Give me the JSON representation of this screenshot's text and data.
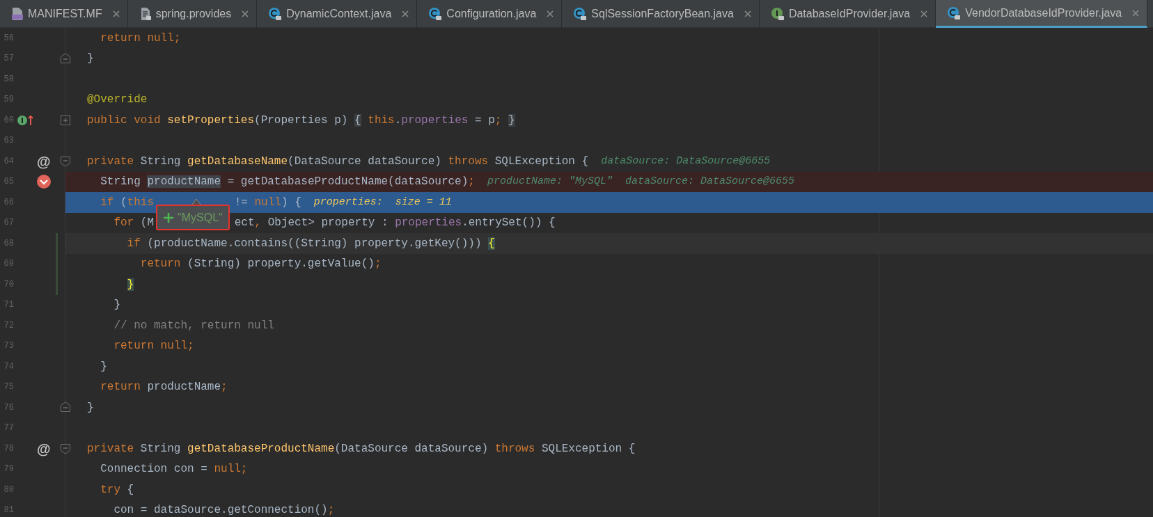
{
  "tabs": [
    {
      "label": "MANIFEST.MF",
      "kind": "manifest",
      "selected": false
    },
    {
      "label": "spring.provides",
      "kind": "text",
      "selected": false
    },
    {
      "label": "DynamicContext.java",
      "kind": "class",
      "selected": false
    },
    {
      "label": "Configuration.java",
      "kind": "class",
      "selected": false
    },
    {
      "label": "SqlSessionFactoryBean.java",
      "kind": "class",
      "selected": false
    },
    {
      "label": "DatabaseIdProvider.java",
      "kind": "interface",
      "selected": false
    },
    {
      "label": "VendorDatabaseIdProvider.java",
      "kind": "class",
      "selected": true
    }
  ],
  "editor": {
    "lines": [
      {
        "number": "56",
        "tokens": [
          {
            "kind": "keyword",
            "text": "  return null;"
          }
        ]
      },
      {
        "number": "57",
        "fold": {
          "kind": "end"
        },
        "tokens": [
          {
            "kind": "plain",
            "text": "}"
          }
        ]
      },
      {
        "number": "58"
      },
      {
        "number": "59",
        "tokens": [
          {
            "kind": "annotation",
            "text": "@Override"
          }
        ]
      },
      {
        "number": "60",
        "fold": {
          "kind": "collapsed"
        },
        "mark": {
          "kind": "implements"
        },
        "tokens": [
          {
            "kind": "keyword",
            "text": "public void "
          },
          {
            "kind": "method",
            "text": "setProperties"
          },
          {
            "kind": "plain",
            "text": "(Properties p) "
          },
          {
            "kind": "folded",
            "text": "{"
          },
          {
            "kind": "keyword",
            "text": " this"
          },
          {
            "kind": "plain",
            "text": "."
          },
          {
            "kind": "field",
            "text": "properties"
          },
          {
            "kind": "plain",
            "text": " = p"
          },
          {
            "kind": "keyword",
            "text": ";"
          },
          {
            "kind": "folded",
            "text": " }"
          }
        ]
      },
      {
        "number": "63"
      },
      {
        "number": "64",
        "fold": {
          "kind": "start"
        },
        "mark": {
          "kind": "symbol",
          "text": "@"
        },
        "tokens": [
          {
            "kind": "keyword",
            "text": "private "
          },
          {
            "kind": "plain",
            "text": "String "
          },
          {
            "kind": "method",
            "text": "getDatabaseName"
          },
          {
            "kind": "plain",
            "text": "(DataSource dataSource) "
          },
          {
            "kind": "keyword",
            "text": "throws "
          },
          {
            "kind": "plain",
            "text": "SQLException {"
          }
        ],
        "hints": [
          "dataSource: DataSource@6655"
        ]
      },
      {
        "number": "65",
        "highlight": {
          "kind": "breakpoint"
        },
        "mark": {
          "kind": "breakpoint"
        },
        "tokens": [
          {
            "kind": "plain",
            "text": "  String "
          },
          {
            "kind": "usage",
            "text": "productName"
          },
          {
            "kind": "plain",
            "text": " = getDatabaseProductName(dataSource)"
          },
          {
            "kind": "keyword",
            "text": ";"
          }
        ],
        "hints": [
          "productName: \"MySQL\"",
          "dataSource: DataSource@6655"
        ]
      },
      {
        "number": "66",
        "highlight": {
          "kind": "execution"
        },
        "tokens": [
          {
            "kind": "keyword",
            "text": "  if "
          },
          {
            "kind": "plain",
            "text": "("
          },
          {
            "kind": "keyword",
            "text": "this"
          },
          {
            "kind": "covered"
          },
          {
            "kind": "plain",
            "text": "!= "
          },
          {
            "kind": "keyword",
            "text": "null"
          },
          {
            "kind": "plain",
            "text": ") {"
          }
        ],
        "hints": [
          "properties:  size = 11"
        ]
      },
      {
        "number": "67",
        "tokens": [
          {
            "kind": "keyword",
            "text": "    for "
          },
          {
            "kind": "plain",
            "text": "(M"
          },
          {
            "kind": "covered"
          },
          {
            "kind": "plain",
            "text": "ect"
          },
          {
            "kind": "keyword",
            "text": ", "
          },
          {
            "kind": "plain",
            "text": "Object> property : "
          },
          {
            "kind": "field",
            "text": "properties"
          },
          {
            "kind": "plain",
            "text": ".entrySet()) {"
          }
        ]
      },
      {
        "number": "68",
        "highlight": {
          "kind": "caret"
        },
        "changed": true,
        "tokens": [
          {
            "kind": "keyword",
            "text": "      if "
          },
          {
            "kind": "plain",
            "text": "(productName.contains((String) property.getKey())) "
          },
          {
            "kind": "brace",
            "text": "{"
          }
        ]
      },
      {
        "number": "69",
        "changed": true,
        "tokens": [
          {
            "kind": "keyword",
            "text": "        return "
          },
          {
            "kind": "plain",
            "text": "(String) property.getValue()"
          },
          {
            "kind": "keyword",
            "text": ";"
          }
        ]
      },
      {
        "number": "70",
        "changed": true,
        "tokens": [
          {
            "kind": "brace",
            "text": "      }"
          }
        ]
      },
      {
        "number": "71",
        "tokens": [
          {
            "kind": "plain",
            "text": "    }"
          }
        ]
      },
      {
        "number": "72",
        "tokens": [
          {
            "kind": "comment",
            "text": "    // no match, return null"
          }
        ]
      },
      {
        "number": "73",
        "tokens": [
          {
            "kind": "keyword",
            "text": "    return null;"
          }
        ]
      },
      {
        "number": "74",
        "tokens": [
          {
            "kind": "plain",
            "text": "  }"
          }
        ]
      },
      {
        "number": "75",
        "tokens": [
          {
            "kind": "keyword",
            "text": "  return "
          },
          {
            "kind": "plain",
            "text": "productName"
          },
          {
            "kind": "keyword",
            "text": ";"
          }
        ]
      },
      {
        "number": "76",
        "fold": {
          "kind": "end"
        },
        "tokens": [
          {
            "kind": "plain",
            "text": "}"
          }
        ]
      },
      {
        "number": "77"
      },
      {
        "number": "78",
        "fold": {
          "kind": "start"
        },
        "mark": {
          "kind": "symbol",
          "text": "@"
        },
        "tokens": [
          {
            "kind": "keyword",
            "text": "private "
          },
          {
            "kind": "plain",
            "text": "String "
          },
          {
            "kind": "method",
            "text": "getDatabaseProductName"
          },
          {
            "kind": "plain",
            "text": "(DataSource dataSource) "
          },
          {
            "kind": "keyword",
            "text": "throws "
          },
          {
            "kind": "plain",
            "text": "SQLException {"
          }
        ]
      },
      {
        "number": "79",
        "tokens": [
          {
            "kind": "plain",
            "text": "  Connection con = "
          },
          {
            "kind": "keyword",
            "text": "null;"
          }
        ]
      },
      {
        "number": "80",
        "tokens": [
          {
            "kind": "keyword",
            "text": "  try "
          },
          {
            "kind": "plain",
            "text": "{"
          }
        ]
      },
      {
        "number": "81",
        "tokens": [
          {
            "kind": "plain",
            "text": "    con = dataSource.getConnection()"
          },
          {
            "kind": "keyword",
            "text": ";"
          }
        ]
      }
    ]
  },
  "popup": {
    "value": "\"MySQL\""
  }
}
